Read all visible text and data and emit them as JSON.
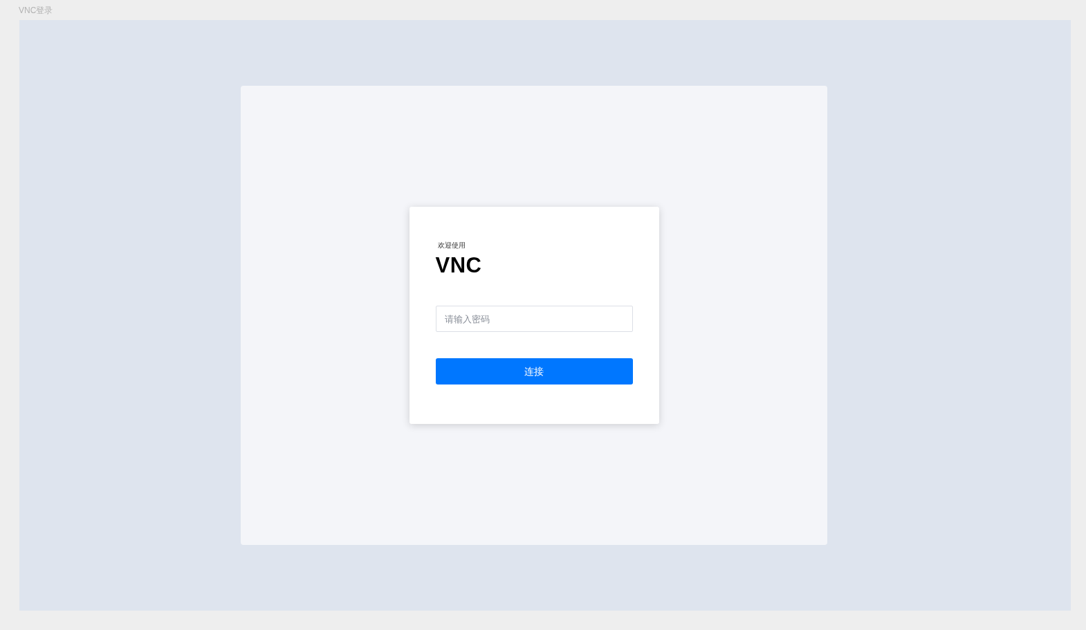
{
  "window": {
    "title": "VNC登录"
  },
  "login": {
    "greeting": "欢迎使用",
    "product": "VNC",
    "password": {
      "placeholder": "请输入密码"
    },
    "connect_button": "连接"
  }
}
